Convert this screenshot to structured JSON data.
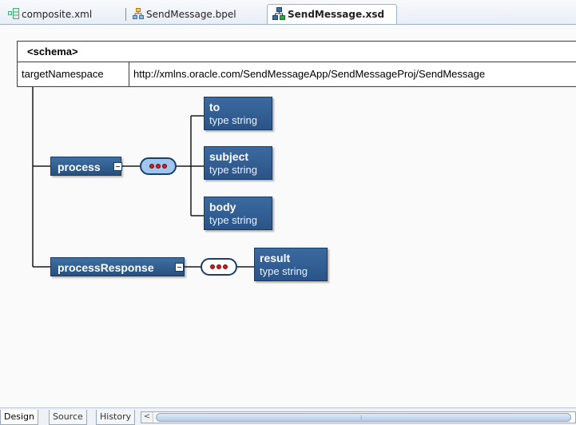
{
  "tabs": [
    {
      "label": "composite.xml",
      "icon": "composite-icon",
      "active": false
    },
    {
      "label": "SendMessage.bpel",
      "icon": "bpel-process-icon",
      "active": false
    },
    {
      "label": "SendMessage.xsd",
      "icon": "xsd-schema-icon",
      "active": true
    }
  ],
  "schema": {
    "title": "<schema>",
    "attr_name": "targetNamespace",
    "attr_value": "http://xmlns.oracle.com/SendMessageApp/SendMessageProj/SendMessage"
  },
  "elements": [
    {
      "name": "process",
      "children": [
        {
          "name": "to",
          "type": "type string"
        },
        {
          "name": "subject",
          "type": "type string"
        },
        {
          "name": "body",
          "type": "type string"
        }
      ]
    },
    {
      "name": "processResponse",
      "children": [
        {
          "name": "result",
          "type": "type string"
        }
      ]
    }
  ],
  "bottom_tabs": [
    {
      "label": "Design",
      "active": true
    },
    {
      "label": "Source",
      "active": false
    },
    {
      "label": "History",
      "active": false
    }
  ],
  "scroll_left_glyph": "<",
  "colors": {
    "node_fill": "#2f5d92",
    "sequence_ring": "#1c3e66",
    "sequence_dot": "#d02020",
    "tab_border": "#9fb2cd"
  }
}
